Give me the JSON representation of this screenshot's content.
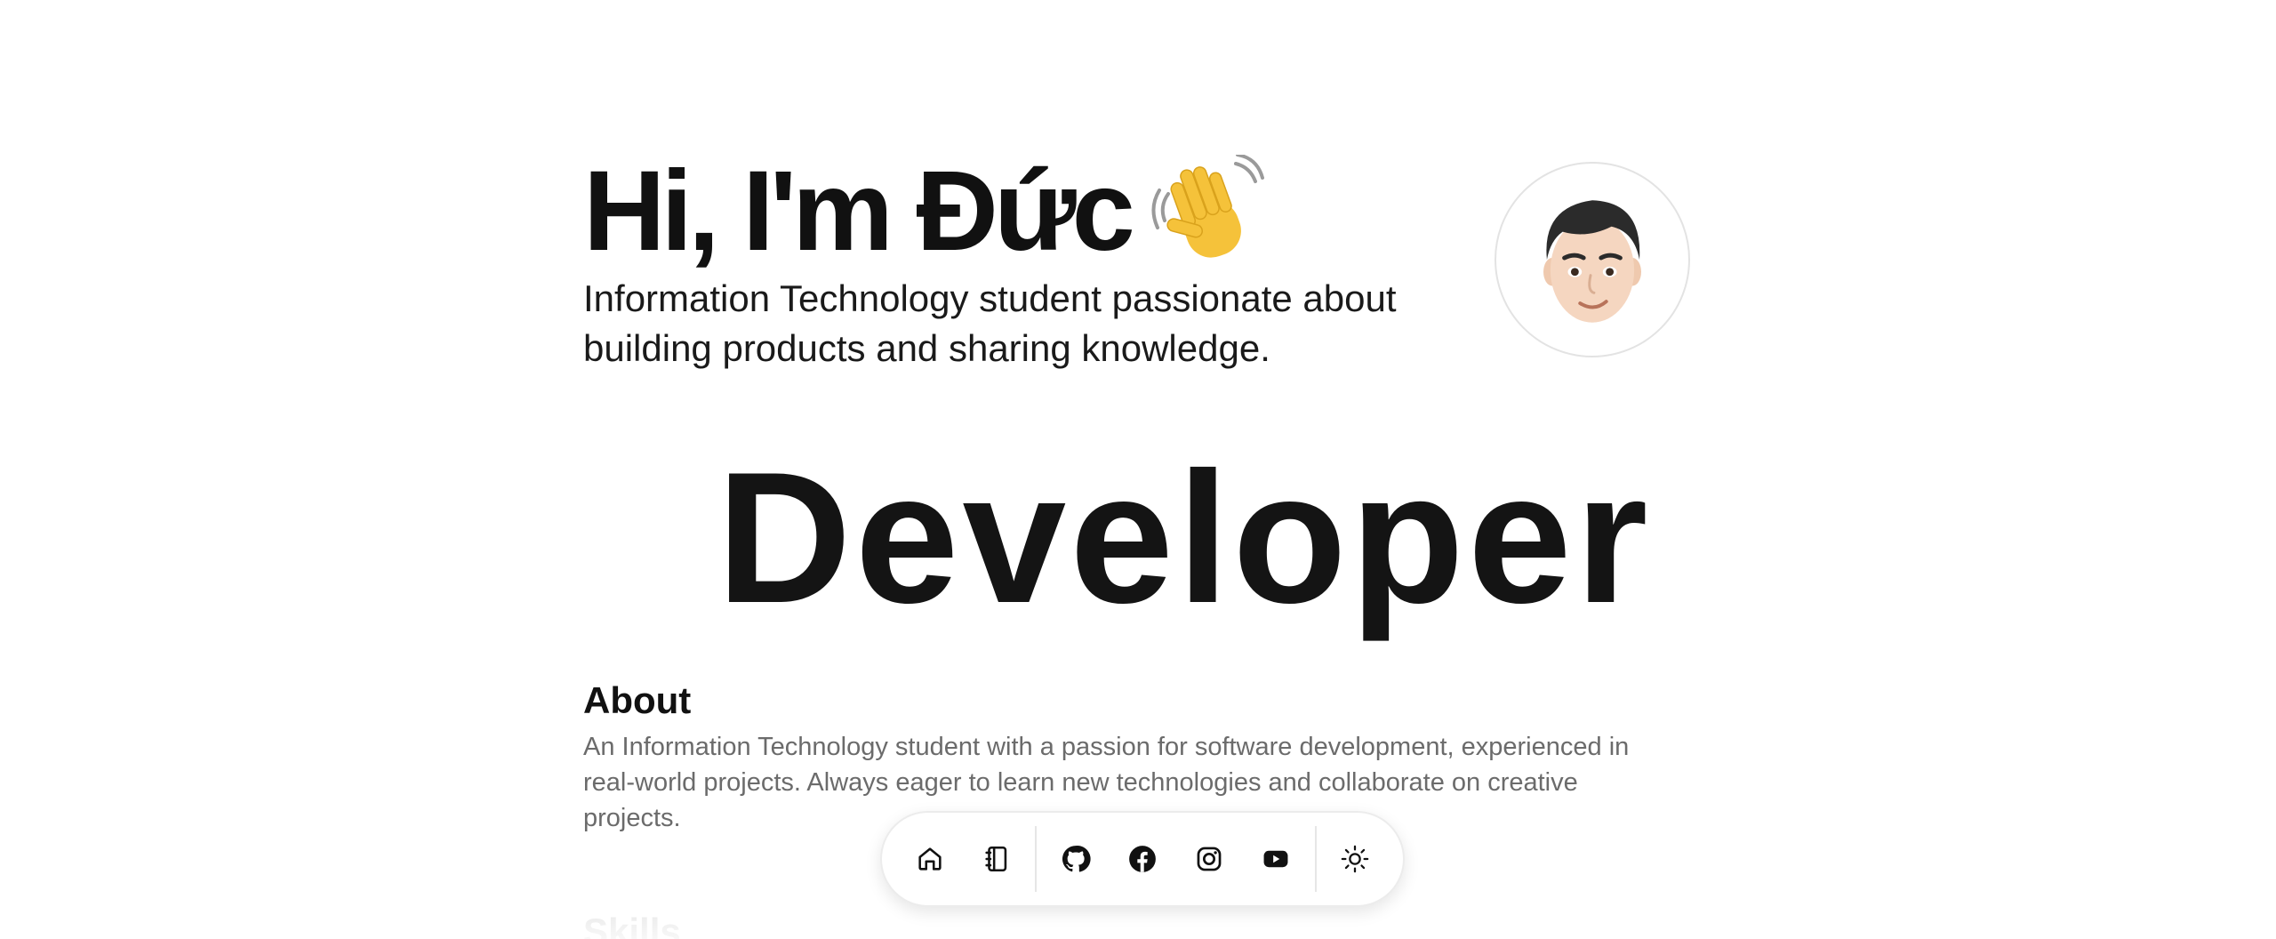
{
  "hero": {
    "greeting": "Hi, I'm Đức",
    "tagline": "Information Technology student passionate about building products and sharing knowledge."
  },
  "banner": {
    "word": "Developer"
  },
  "about": {
    "heading": "About",
    "text": "An Information Technology student with a passion for software development, experienced in real-world projects. Always eager to learn new technologies and collaborate on creative projects."
  },
  "skills": {
    "heading": "Skills"
  },
  "dock": {
    "items": [
      {
        "icon": "home-icon"
      },
      {
        "icon": "notebook-icon"
      },
      {
        "icon": "github-icon"
      },
      {
        "icon": "facebook-icon"
      },
      {
        "icon": "instagram-icon"
      },
      {
        "icon": "youtube-icon"
      },
      {
        "icon": "sun-icon"
      }
    ]
  },
  "colors": {
    "text": "#111111",
    "muted": "#6b6b6b",
    "wave_emoji": "#F5C23A"
  }
}
